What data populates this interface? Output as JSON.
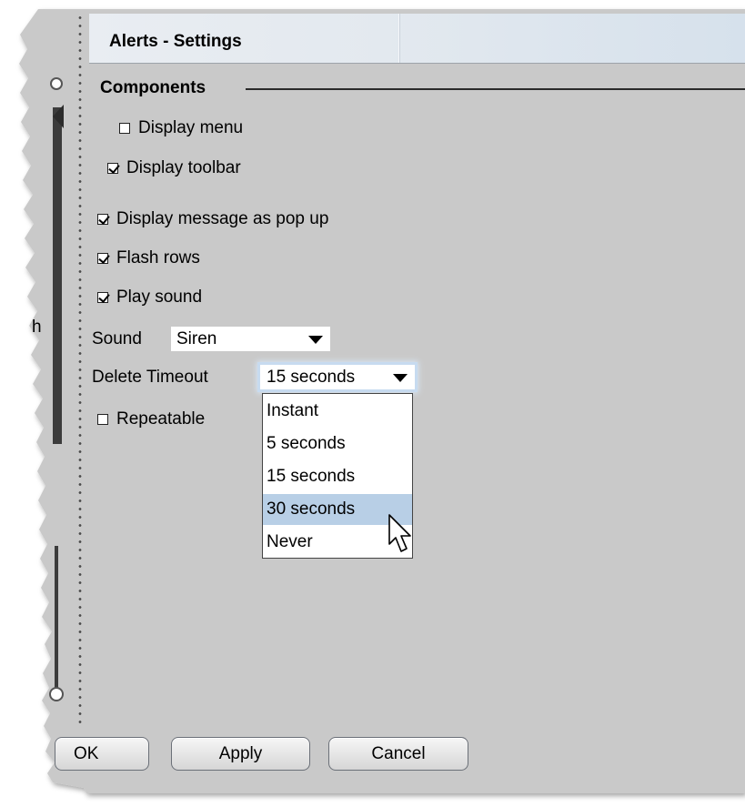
{
  "window": {
    "title": "Alerts - Settings"
  },
  "components": {
    "heading": "Components",
    "display_menu": {
      "label": "Display menu",
      "checked": false
    },
    "display_toolbar": {
      "label": "Display toolbar",
      "checked": true
    }
  },
  "options": {
    "popup": {
      "label": "Display message as pop up",
      "checked": true
    },
    "flash_rows": {
      "label": "Flash rows",
      "checked": true
    },
    "play_sound": {
      "label": "Play sound",
      "checked": true
    },
    "sound": {
      "label": "Sound",
      "value": "Siren"
    },
    "delete_timeout": {
      "label": "Delete Timeout",
      "value": "15 seconds",
      "options": [
        "Instant",
        "5 seconds",
        "15 seconds",
        "30 seconds",
        "Never"
      ],
      "highlighted": "30 seconds"
    },
    "repeatable": {
      "label": "Repeatable",
      "checked": false
    }
  },
  "background_fragment": "h",
  "buttons": {
    "ok": "OK",
    "apply": "Apply",
    "cancel": "Cancel"
  },
  "colors": {
    "panel": "#c8c8c8",
    "highlight": "#b8cfe6",
    "header": "#e3e9ef"
  }
}
